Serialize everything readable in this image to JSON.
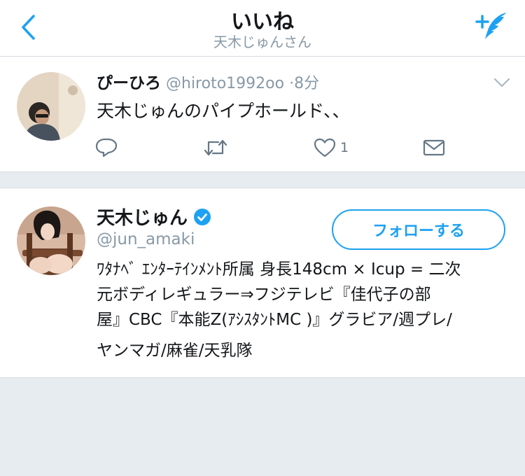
{
  "header": {
    "title": "いいね",
    "subtitle": "天木じゅんさん"
  },
  "tweet": {
    "name": "ぴーひろ",
    "handle": "@hiroto1992oo",
    "dot": "·",
    "time": "8分",
    "text": "天木じゅんのパイプホールド、、",
    "like_count": "1"
  },
  "profile": {
    "name": "天木じゅん",
    "handle": "@jun_amaki",
    "follow_label": "フォローする",
    "bio_lines": [
      "ﾜﾀﾅﾍﾞ ｴﾝﾀｰﾃｲﾝﾒﾝﾄ所属 身長148cm × Icup = 二次",
      "元ボディレギュラー⇒フジテレビ『佳代子の部",
      "屋』CBC『本能Z(ｱｼｽﾀﾝﾄMC )』グラビア/週プレ/",
      "ヤンマガ/麻雀/天乳隊"
    ]
  },
  "colors": {
    "accent": "#1da1f2",
    "muted": "#8899a6",
    "background": "#e6ecf0"
  },
  "icons": {
    "back": "chevron-left-icon",
    "compose": "compose-tweet-icon",
    "caret": "chevron-down-icon",
    "reply": "reply-icon",
    "retweet": "retweet-icon",
    "like": "heart-icon",
    "dm": "envelope-icon",
    "verified": "verified-badge-icon"
  }
}
